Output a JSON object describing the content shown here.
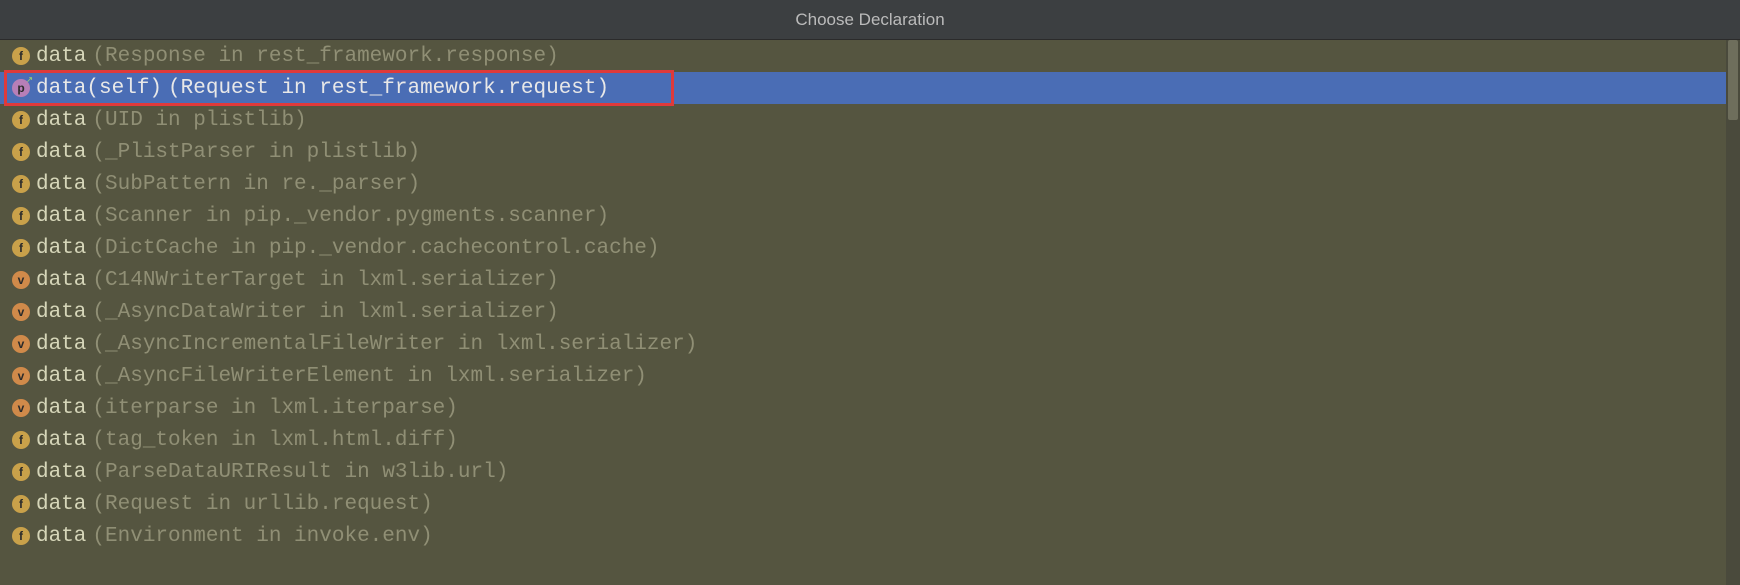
{
  "window": {
    "title": "Choose Declaration"
  },
  "items": [
    {
      "icon": "f",
      "name": "data",
      "qualifier": "(Response in rest_framework.response)",
      "selected": false,
      "highlight": false
    },
    {
      "icon": "p",
      "name": "data(self)",
      "qualifier": "(Request in rest_framework.request)",
      "selected": true,
      "highlight": true,
      "arrow": true
    },
    {
      "icon": "f",
      "name": "data",
      "qualifier": "(UID in plistlib)",
      "selected": false,
      "highlight": false
    },
    {
      "icon": "f",
      "name": "data",
      "qualifier": "(_PlistParser in plistlib)",
      "selected": false,
      "highlight": false
    },
    {
      "icon": "f",
      "name": "data",
      "qualifier": "(SubPattern in re._parser)",
      "selected": false,
      "highlight": false
    },
    {
      "icon": "f",
      "name": "data",
      "qualifier": "(Scanner in pip._vendor.pygments.scanner)",
      "selected": false,
      "highlight": false
    },
    {
      "icon": "f",
      "name": "data",
      "qualifier": "(DictCache in pip._vendor.cachecontrol.cache)",
      "selected": false,
      "highlight": false
    },
    {
      "icon": "v",
      "name": "data",
      "qualifier": "(C14NWriterTarget in lxml.serializer)",
      "selected": false,
      "highlight": false
    },
    {
      "icon": "v",
      "name": "data",
      "qualifier": "(_AsyncDataWriter in lxml.serializer)",
      "selected": false,
      "highlight": false
    },
    {
      "icon": "v",
      "name": "data",
      "qualifier": "(_AsyncIncrementalFileWriter in lxml.serializer)",
      "selected": false,
      "highlight": false
    },
    {
      "icon": "v",
      "name": "data",
      "qualifier": "(_AsyncFileWriterElement in lxml.serializer)",
      "selected": false,
      "highlight": false
    },
    {
      "icon": "v",
      "name": "data",
      "qualifier": "(iterparse in lxml.iterparse)",
      "selected": false,
      "highlight": false
    },
    {
      "icon": "f",
      "name": "data",
      "qualifier": "(tag_token in lxml.html.diff)",
      "selected": false,
      "highlight": false
    },
    {
      "icon": "f",
      "name": "data",
      "qualifier": "(ParseDataURIResult in w3lib.url)",
      "selected": false,
      "highlight": false
    },
    {
      "icon": "f",
      "name": "data",
      "qualifier": "(Request in urllib.request)",
      "selected": false,
      "highlight": false
    },
    {
      "icon": "f",
      "name": "data",
      "qualifier": "(Environment in invoke.env)",
      "selected": false,
      "highlight": false
    }
  ],
  "iconLabels": {
    "f": "f",
    "p": "p",
    "v": "v"
  }
}
